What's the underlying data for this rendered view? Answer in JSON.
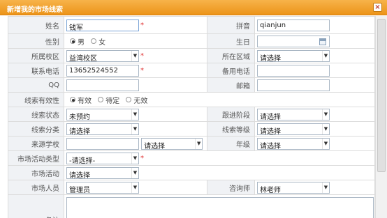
{
  "dialog": {
    "title": "新增我的市场线索",
    "close_glyph": "×"
  },
  "fields": {
    "name": {
      "label": "姓名",
      "value": "钱军"
    },
    "pinyin": {
      "label": "拼音",
      "value": "qianjun"
    },
    "gender": {
      "label": "性别",
      "options": [
        "男",
        "女"
      ],
      "selected": "男"
    },
    "birthday": {
      "label": "生日",
      "value": ""
    },
    "campus": {
      "label": "所属校区",
      "value": "益湾校区"
    },
    "region": {
      "label": "所在区域",
      "value": "请选择"
    },
    "phone": {
      "label": "联系电话",
      "value": "13652524552"
    },
    "backup_phone": {
      "label": "备用电话",
      "value": ""
    },
    "qq": {
      "label": "QQ",
      "value": ""
    },
    "email": {
      "label": "邮箱",
      "value": ""
    },
    "validity": {
      "label": "线索有效性",
      "options": [
        "有效",
        "待定",
        "无效"
      ],
      "selected": "有效"
    },
    "status": {
      "label": "线索状态",
      "value": "未预约"
    },
    "followup_stage": {
      "label": "跟进阶段",
      "value": "请选择"
    },
    "category": {
      "label": "线索分类",
      "value": "请选择"
    },
    "level": {
      "label": "线索等级",
      "value": "请选择"
    },
    "source_school": {
      "label": "来源学校",
      "value": "",
      "select_value": "请选择"
    },
    "grade": {
      "label": "年级",
      "value": "请选择"
    },
    "activity_type": {
      "label": "市场活动类型",
      "value": "-请选择-"
    },
    "activity": {
      "label": "市场活动",
      "value": "请选择"
    },
    "staff": {
      "label": "市场人员",
      "value": "管理员"
    },
    "consultant": {
      "label": "咨询师",
      "value": "林老师"
    },
    "remark": {
      "label": "备注",
      "value": ""
    }
  },
  "required_mark": "*",
  "colors": {
    "titlebar": "#ec9419",
    "label_bg": "#f0f2f5",
    "required": "#e03030"
  }
}
